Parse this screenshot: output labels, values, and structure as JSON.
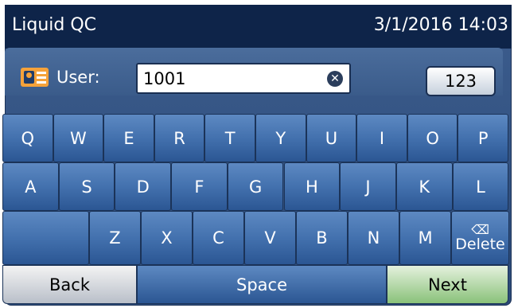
{
  "header": {
    "title": "Liquid QC",
    "datetime": "3/1/2016 14:03"
  },
  "user_panel": {
    "icon": "id-card-icon",
    "label": "User:",
    "value": "1001",
    "clear_icon": "clear-icon",
    "mode_button": "123"
  },
  "keyboard": {
    "row1": [
      "Q",
      "W",
      "E",
      "R",
      "T",
      "Y",
      "U",
      "I",
      "O",
      "P"
    ],
    "row2": [
      "A",
      "S",
      "D",
      "F",
      "G",
      "H",
      "J",
      "K",
      "L"
    ],
    "row3": [
      "",
      "Z",
      "X",
      "C",
      "V",
      "B",
      "N",
      "M"
    ],
    "delete_label": "Delete",
    "delete_icon": "backspace-icon"
  },
  "bottom": {
    "back": "Back",
    "space": "Space",
    "next": "Next"
  },
  "colors": {
    "title_bar": "#0e2449",
    "key": "#4371ae",
    "next": "#8ac27a",
    "badge": "#f5a23a"
  }
}
